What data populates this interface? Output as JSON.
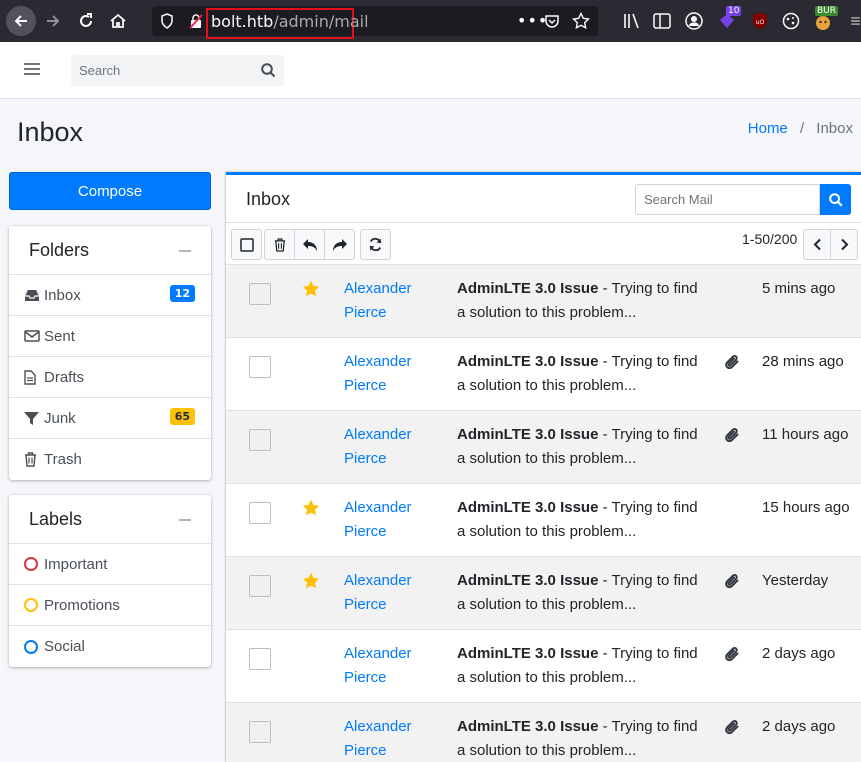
{
  "browser": {
    "url_host": "bolt.htb",
    "url_path": "/admin/mail",
    "ext_badge_count": "10",
    "burp_label": "BUR"
  },
  "topnav": {
    "search_placeholder": "Search"
  },
  "page": {
    "title": "Inbox",
    "breadcrumb_home": "Home",
    "breadcrumb_sep": "/",
    "breadcrumb_current": "Inbox"
  },
  "sidebar": {
    "compose_label": "Compose",
    "folders_title": "Folders",
    "folders": [
      {
        "label": "Inbox",
        "badge": "12",
        "icon": "inbox-icon"
      },
      {
        "label": "Sent",
        "icon": "envelope-icon"
      },
      {
        "label": "Drafts",
        "icon": "file-icon"
      },
      {
        "label": "Junk",
        "badge": "65",
        "icon": "filter-icon"
      },
      {
        "label": "Trash",
        "icon": "trash-icon"
      }
    ],
    "labels_title": "Labels",
    "labels": [
      {
        "label": "Important",
        "color": "#dc3545"
      },
      {
        "label": "Promotions",
        "color": "#ffc107"
      },
      {
        "label": "Social",
        "color": "#007bff"
      }
    ]
  },
  "mail": {
    "title": "Inbox",
    "search_placeholder": "Search Mail",
    "pager": "1-50/200",
    "messages": [
      {
        "from": "Alexander Pierce",
        "subject": "AdminLTE 3.0 Issue",
        "preview": " - Trying to find a solution to this problem...",
        "date": "5 mins ago",
        "starred": true,
        "attachment": false
      },
      {
        "from": "Alexander Pierce",
        "subject": "AdminLTE 3.0 Issue",
        "preview": " - Trying to find a solution to this problem...",
        "date": "28 mins ago",
        "starred": false,
        "attachment": true
      },
      {
        "from": "Alexander Pierce",
        "subject": "AdminLTE 3.0 Issue",
        "preview": " - Trying to find a solution to this problem...",
        "date": "11 hours ago",
        "starred": false,
        "attachment": true
      },
      {
        "from": "Alexander Pierce",
        "subject": "AdminLTE 3.0 Issue",
        "preview": " - Trying to find a solution to this problem...",
        "date": "15 hours ago",
        "starred": true,
        "attachment": false
      },
      {
        "from": "Alexander Pierce",
        "subject": "AdminLTE 3.0 Issue",
        "preview": " - Trying to find a solution to this problem...",
        "date": "Yesterday",
        "starred": true,
        "attachment": true
      },
      {
        "from": "Alexander Pierce",
        "subject": "AdminLTE 3.0 Issue",
        "preview": " - Trying to find a solution to this problem...",
        "date": "2 days ago",
        "starred": false,
        "attachment": true
      },
      {
        "from": "Alexander Pierce",
        "subject": "AdminLTE 3.0 Issue",
        "preview": " - Trying to find a solution to this problem...",
        "date": "2 days ago",
        "starred": false,
        "attachment": true
      }
    ]
  },
  "colors": {
    "primary": "#007bff",
    "star": "#ffc107",
    "badge_blue": "#007bff",
    "badge_yellow": "#ffc107"
  }
}
